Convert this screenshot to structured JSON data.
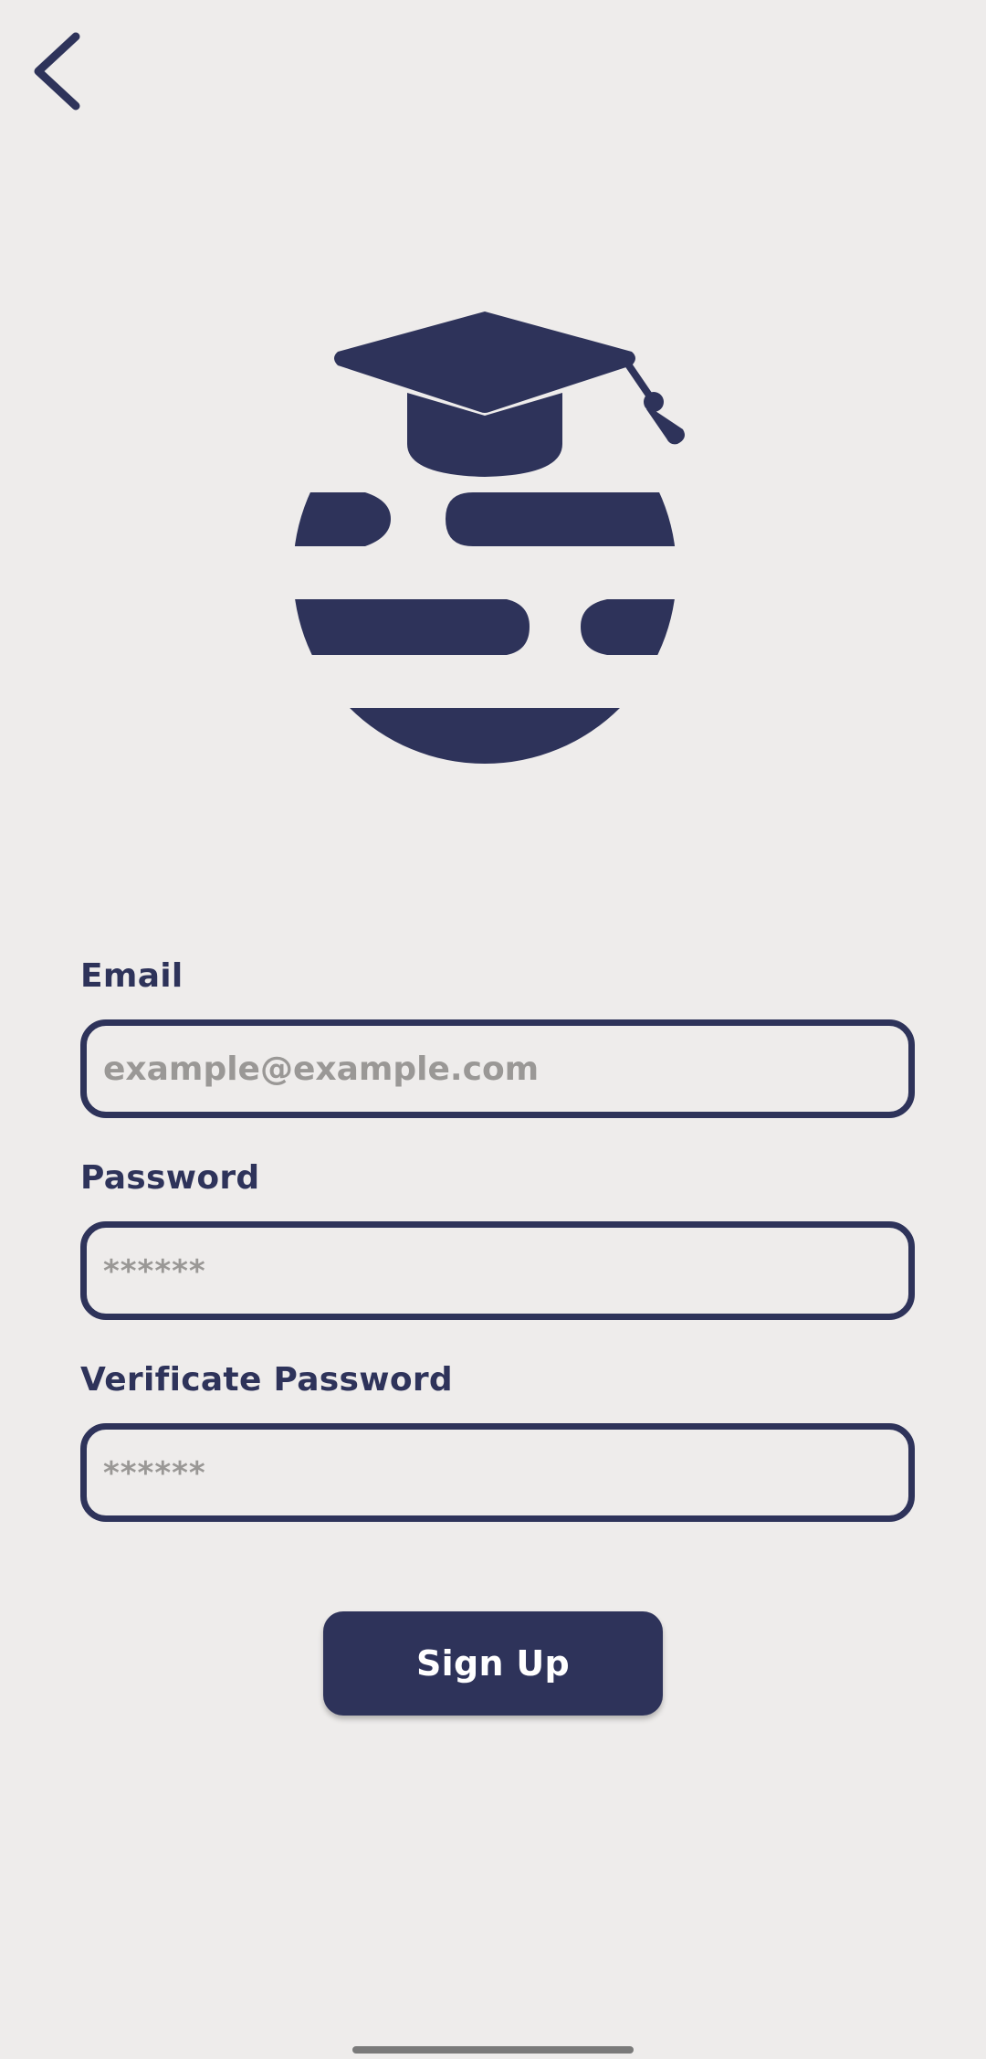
{
  "nav": {
    "back_icon": "chevron-left-icon"
  },
  "logo": {
    "icon": "graduation-cap-globe-logo"
  },
  "form": {
    "email_label": "Email",
    "email_value": "",
    "email_placeholder": "example@example.com",
    "password_label": "Password",
    "password_value": "",
    "password_placeholder": "******",
    "verify_label": "Verificate Password",
    "verify_value": "",
    "verify_placeholder": "******",
    "submit_label": "Sign Up"
  },
  "colors": {
    "primary": "#2e335a",
    "background": "#eeeceb",
    "placeholder": "#9a9896",
    "button_text": "#ffffff"
  }
}
